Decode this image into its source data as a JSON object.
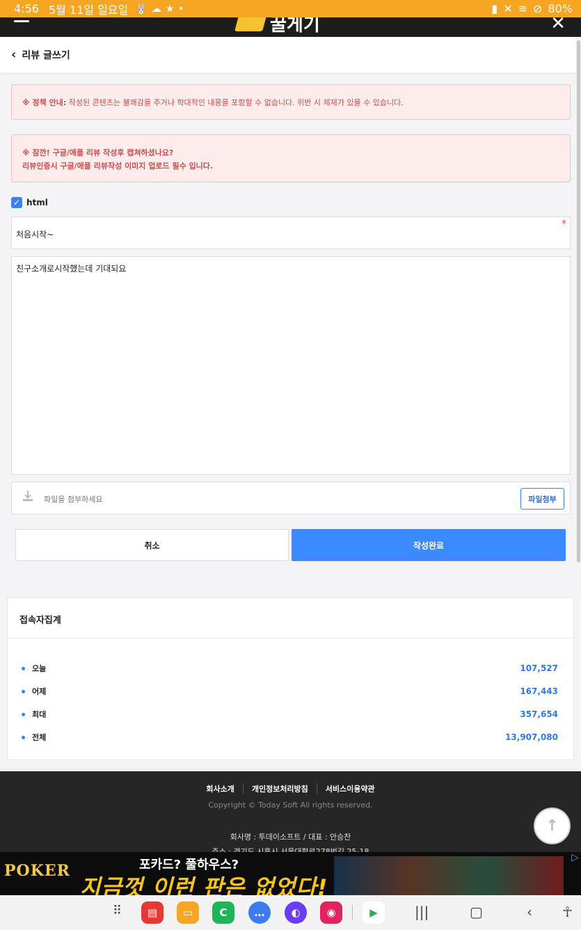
{
  "status_bar": {
    "time": "4:56",
    "date": "5월 11일 일요일",
    "battery": "80%"
  },
  "app_header": {
    "logo_text": "꿀게기"
  },
  "page": {
    "back_icon": "chevron-left-icon",
    "title": "리뷰 글쓰기"
  },
  "notices": {
    "policy_label": "※ 정책 안내:",
    "policy_text": " 작성된 콘텐츠는 불쾌감을 주거나 학대적인 내용을 포함할 수 없습니다. 위반 시 제재가 있을 수 있습니다.",
    "capture_line1": "※ 잠깐! 구글/애플 리뷰 작성후 캡쳐하셨나요?",
    "capture_line2": "리뷰인증시 구글/애플 리뷰작성 이미지 업로드 필수 입니다."
  },
  "form": {
    "html_label": "html",
    "html_checked": true,
    "title_value": "처음시작~",
    "required_mark": "*",
    "content_value": "친구소개로시작했는데 기대되요",
    "file_placeholder": "파일을 첨부하세요",
    "attach_label": "파일첨부",
    "cancel_label": "취소",
    "submit_label": "작성완료"
  },
  "stats": {
    "title": "접속자집계",
    "rows": [
      {
        "label": "오늘",
        "value": "107,527"
      },
      {
        "label": "어제",
        "value": "167,443"
      },
      {
        "label": "최대",
        "value": "357,654"
      },
      {
        "label": "전체",
        "value": "13,907,080"
      }
    ]
  },
  "footer": {
    "links": [
      "회사소개",
      "개인정보처리방침",
      "서비스이용약관"
    ],
    "copyright": "Copyright © Today Soft All rights reserved.",
    "company": "회사명 : 투데이소프트 / 대표 : 안승찬",
    "address": "주소 : 경기도 시흥시 서울대학로278번길 25-18"
  },
  "ad": {
    "brand": "POKER",
    "top_text": "포카드? 풀하우스?",
    "main_text": "지금껏 이런 판은 없었다!"
  },
  "colors": {
    "accent": "#3b8aff",
    "status_bar": "#f6a623",
    "notice_bg": "#fdecec",
    "notice_text": "#d14b4b"
  }
}
